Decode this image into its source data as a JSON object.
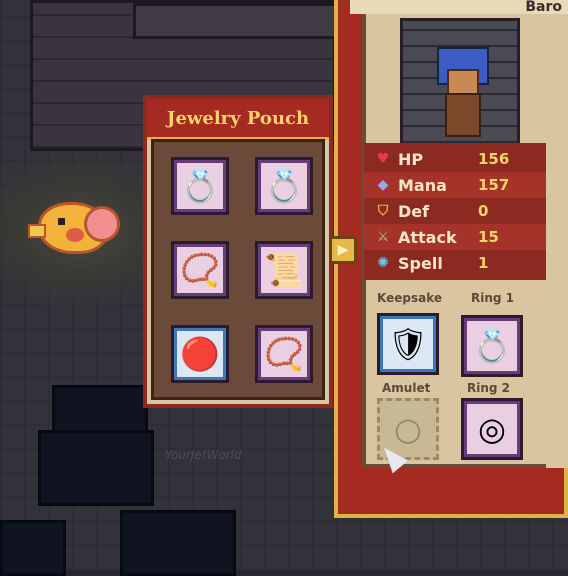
{
  "pouch": {
    "title": "Jewelry Pouch",
    "items": [
      {
        "icon": "emerald-serpent-ring",
        "glyph": "💍"
      },
      {
        "icon": "diamond-gold-ring",
        "glyph": "💍"
      },
      {
        "icon": "rope-amulet",
        "glyph": "📿"
      },
      {
        "icon": "rune-tablet",
        "glyph": "📜"
      },
      {
        "icon": "ruby-pendant",
        "glyph": "🔴"
      },
      {
        "icon": "beaded-bracelet",
        "glyph": "📿"
      }
    ]
  },
  "character": {
    "name": "Baro",
    "stats": [
      {
        "icon": "heart-icon",
        "glyph": "♥",
        "color": "#e53b4a",
        "label": "HP",
        "value": "156"
      },
      {
        "icon": "crystal-icon",
        "glyph": "◆",
        "color": "#9aa6e8",
        "label": "Mana",
        "value": "157"
      },
      {
        "icon": "helmet-icon",
        "glyph": "⛉",
        "color": "#e0b24a",
        "label": "Def",
        "value": "0"
      },
      {
        "icon": "sword-icon",
        "glyph": "⚔",
        "color": "#a9c26a",
        "label": "Attack",
        "value": "15"
      },
      {
        "icon": "spark-icon",
        "glyph": "✺",
        "color": "#6ac6f4",
        "label": "Spell",
        "value": "1"
      }
    ],
    "equipment": {
      "keepsake": {
        "label": "Keepsake",
        "icon": "shield-icon",
        "glyph": "🛡"
      },
      "ring1": {
        "label": "Ring 1",
        "icon": "ruby-ring-icon",
        "glyph": "💍"
      },
      "amulet": {
        "label": "Amulet",
        "icon": "empty-amulet-icon",
        "glyph": "○"
      },
      "ring2": {
        "label": "Ring 2",
        "icon": "bronze-ring-icon",
        "glyph": "◎"
      }
    }
  },
  "watermark": "YourJetWorld"
}
